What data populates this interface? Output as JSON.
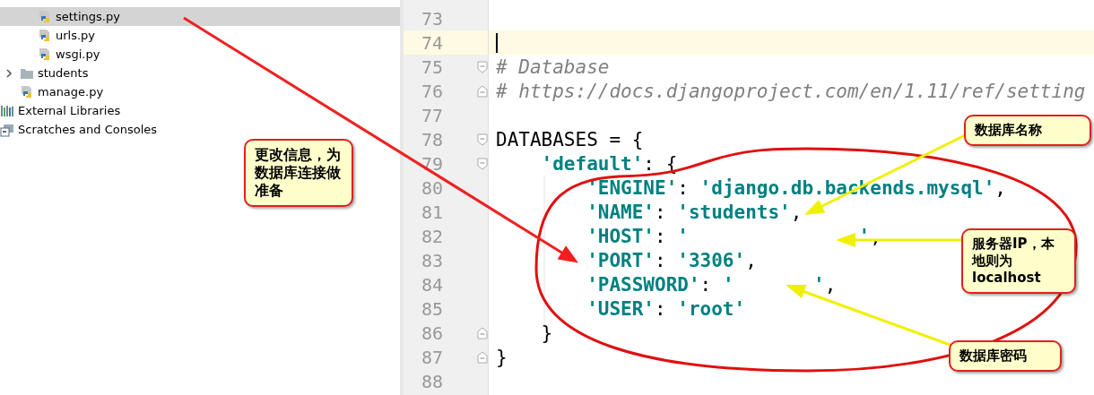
{
  "project_tree": [
    {
      "children": [
        {
          "children": [
            {
              "label": "settings.py",
              "kind": "python_file",
              "selected": true
            },
            {
              "label": "urls.py",
              "kind": "python_file",
              "selected": false
            },
            {
              "label": "wsgi.py",
              "kind": "python_file",
              "selected": false
            }
          ]
        },
        {
          "label": "students",
          "kind": "folder",
          "selected": false,
          "expanded": false
        },
        {
          "label": "manage.py",
          "kind": "python_file",
          "selected": false
        }
      ]
    },
    {
      "label": "External Libraries",
      "kind": "libraries",
      "selected": false
    },
    {
      "label": "Scratches and Consoles",
      "kind": "scratches",
      "selected": false
    }
  ],
  "editor": {
    "lines": [
      {
        "number": "73",
        "current": false,
        "fold_start": false,
        "fold_end": false
      },
      {
        "number": "74",
        "current": true,
        "fold_start": false,
        "fold_end": false
      },
      {
        "number": "75",
        "current": false,
        "fold_start": true,
        "fold_end": false,
        "tokens": [
          {
            "kind": "comment",
            "text": "# Database"
          }
        ]
      },
      {
        "number": "76",
        "current": false,
        "fold_start": false,
        "fold_end": true,
        "tokens": [
          {
            "kind": "comment",
            "text": "# https://docs.djangoproject.com/en/1.11/ref/setting"
          }
        ]
      },
      {
        "number": "77",
        "current": false,
        "fold_start": false,
        "fold_end": false
      },
      {
        "number": "78",
        "current": false,
        "fold_start": true,
        "fold_end": false,
        "tokens": [
          {
            "kind": "plain",
            "text": "DATABASES = {"
          }
        ],
        "children": [
          {
            "number": "79",
            "current": false,
            "fold_start": true,
            "fold_end": false,
            "tokens": [
              {
                "kind": "string",
                "text": "'default'"
              },
              {
                "kind": "plain",
                "text": ": {"
              }
            ],
            "children": [
              {
                "number": "80",
                "current": false,
                "fold_start": false,
                "fold_end": false,
                "tokens": [
                  {
                    "kind": "string",
                    "text": "'ENGINE'"
                  },
                  {
                    "kind": "plain",
                    "text": ": "
                  },
                  {
                    "kind": "string",
                    "text": "'django.db.backends.mysql'"
                  },
                  {
                    "kind": "plain",
                    "text": ","
                  }
                ]
              },
              {
                "number": "81",
                "current": false,
                "fold_start": false,
                "fold_end": false,
                "tokens": [
                  {
                    "kind": "string",
                    "text": "'NAME'"
                  },
                  {
                    "kind": "plain",
                    "text": ": "
                  },
                  {
                    "kind": "string",
                    "text": "'students'"
                  },
                  {
                    "kind": "plain",
                    "text": ","
                  }
                ]
              },
              {
                "number": "82",
                "current": false,
                "fold_start": false,
                "fold_end": false,
                "tokens": [
                  {
                    "kind": "string",
                    "text": "'HOST'"
                  },
                  {
                    "kind": "plain",
                    "text": ": "
                  },
                  {
                    "kind": "string",
                    "text": "'               '"
                  },
                  {
                    "kind": "plain",
                    "text": ","
                  }
                ]
              },
              {
                "number": "83",
                "current": false,
                "fold_start": false,
                "fold_end": false,
                "tokens": [
                  {
                    "kind": "string",
                    "text": "'PORT'"
                  },
                  {
                    "kind": "plain",
                    "text": ": "
                  },
                  {
                    "kind": "string",
                    "text": "'3306'"
                  },
                  {
                    "kind": "plain",
                    "text": ","
                  }
                ]
              },
              {
                "number": "84",
                "current": false,
                "fold_start": false,
                "fold_end": false,
                "tokens": [
                  {
                    "kind": "string",
                    "text": "'PASSWORD'"
                  },
                  {
                    "kind": "plain",
                    "text": ": "
                  },
                  {
                    "kind": "string",
                    "text": "'       '"
                  },
                  {
                    "kind": "plain",
                    "text": ","
                  }
                ]
              },
              {
                "number": "85",
                "current": false,
                "fold_start": false,
                "fold_end": false,
                "tokens": [
                  {
                    "kind": "string",
                    "text": "'USER'"
                  },
                  {
                    "kind": "plain",
                    "text": ": "
                  },
                  {
                    "kind": "string",
                    "text": "'root'"
                  }
                ]
              }
            ]
          },
          {
            "number": "86",
            "current": false,
            "fold_start": false,
            "fold_end": true,
            "tokens": [
              {
                "kind": "plain",
                "text": "}"
              }
            ]
          }
        ]
      },
      {
        "number": "87",
        "current": false,
        "fold_start": false,
        "fold_end": true,
        "tokens": [
          {
            "kind": "plain",
            "text": "}"
          }
        ]
      },
      {
        "number": "88",
        "current": false,
        "fold_start": false,
        "fold_end": false
      }
    ]
  },
  "annotations": [
    {
      "text": "更改信息，为数据库连接做准备"
    },
    {
      "text": "数据库名称"
    },
    {
      "text": "服务器IP，本地则为localhost"
    },
    {
      "text": "数据库密码"
    }
  ]
}
